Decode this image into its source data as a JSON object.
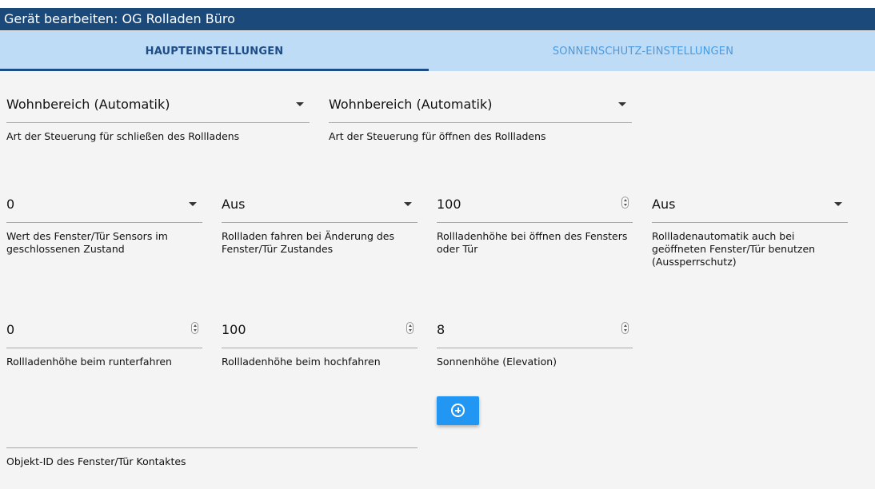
{
  "dialog": {
    "title": "Gerät bearbeiten: OG Rolladen Büro"
  },
  "tabs": [
    {
      "label": "HAUPTEINSTELLUNGEN",
      "active": true
    },
    {
      "label": "SONNENSCHUTZ-EINSTELLUNGEN",
      "active": false
    }
  ],
  "fields": {
    "close_control": {
      "value": "Wohnbereich (Automatik)",
      "label": "Art der Steuerung für schließen des Rollladens"
    },
    "open_control": {
      "value": "Wohnbereich (Automatik)",
      "label": "Art der Steuerung für öffnen des Rollladens"
    },
    "sensor_closed_value": {
      "value": "0",
      "label_lines": [
        "Wert des Fenster/Tür Sensors im",
        "geschlossenen Zustand"
      ]
    },
    "move_on_change": {
      "value": "Aus",
      "label_lines": [
        "Rollladen fahren bei Änderung des",
        "Fenster/Tür Zustandes"
      ]
    },
    "height_window_open": {
      "value": "100",
      "label_lines": [
        "Rollladenhöhe bei öffnen des Fensters",
        "oder Tür"
      ]
    },
    "lockout_protection": {
      "value": "Aus",
      "label_lines": [
        "Rollladenautomatik auch bei",
        "geöffneten Fenster/Tür benutzen",
        "(Aussperrschutz)"
      ]
    },
    "height_down": {
      "value": "0",
      "label": "Rollladenhöhe beim runterfahren"
    },
    "height_up": {
      "value": "100",
      "label": "Rollladenhöhe beim hochfahren"
    },
    "elevation": {
      "value": "8",
      "label": "Sonnenhöhe (Elevation)"
    },
    "contact_object_id": {
      "value": "",
      "label": "Objekt-ID des Fenster/Tür Kontaktes"
    }
  },
  "icons": {
    "dropdown": "chevron-down-icon",
    "stepper": "number-stepper-icon",
    "add": "add-circle-icon"
  },
  "colors": {
    "titlebar": "#1b4a7a",
    "tabbar": "#bfdcf6",
    "active_tab": "#1d4c86",
    "inactive_tab": "#4a9ae0",
    "button": "#2196f3"
  }
}
